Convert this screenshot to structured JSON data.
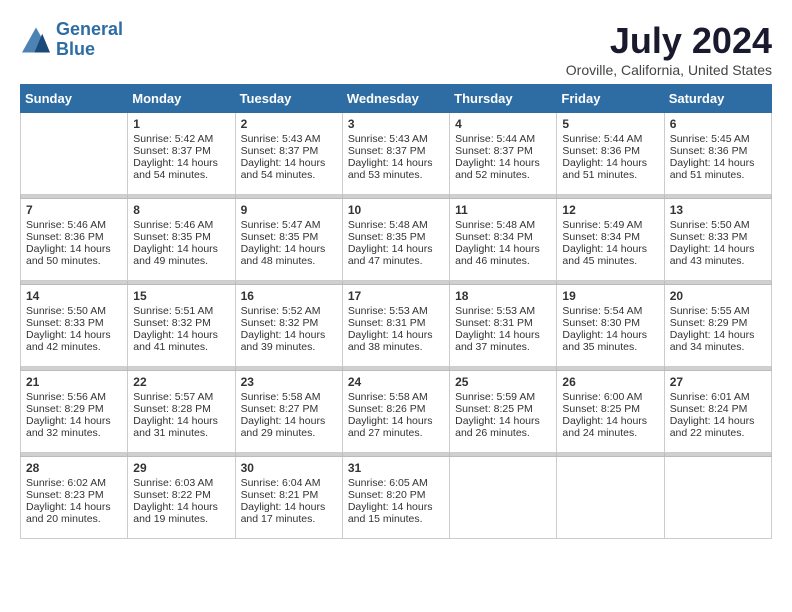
{
  "logo": {
    "line1": "General",
    "line2": "Blue"
  },
  "title": "July 2024",
  "location": "Oroville, California, United States",
  "weekdays": [
    "Sunday",
    "Monday",
    "Tuesday",
    "Wednesday",
    "Thursday",
    "Friday",
    "Saturday"
  ],
  "weeks": [
    [
      {
        "day": "",
        "sunrise": "",
        "sunset": "",
        "daylight": ""
      },
      {
        "day": "1",
        "sunrise": "Sunrise: 5:42 AM",
        "sunset": "Sunset: 8:37 PM",
        "daylight": "Daylight: 14 hours and 54 minutes."
      },
      {
        "day": "2",
        "sunrise": "Sunrise: 5:43 AM",
        "sunset": "Sunset: 8:37 PM",
        "daylight": "Daylight: 14 hours and 54 minutes."
      },
      {
        "day": "3",
        "sunrise": "Sunrise: 5:43 AM",
        "sunset": "Sunset: 8:37 PM",
        "daylight": "Daylight: 14 hours and 53 minutes."
      },
      {
        "day": "4",
        "sunrise": "Sunrise: 5:44 AM",
        "sunset": "Sunset: 8:37 PM",
        "daylight": "Daylight: 14 hours and 52 minutes."
      },
      {
        "day": "5",
        "sunrise": "Sunrise: 5:44 AM",
        "sunset": "Sunset: 8:36 PM",
        "daylight": "Daylight: 14 hours and 51 minutes."
      },
      {
        "day": "6",
        "sunrise": "Sunrise: 5:45 AM",
        "sunset": "Sunset: 8:36 PM",
        "daylight": "Daylight: 14 hours and 51 minutes."
      }
    ],
    [
      {
        "day": "7",
        "sunrise": "Sunrise: 5:46 AM",
        "sunset": "Sunset: 8:36 PM",
        "daylight": "Daylight: 14 hours and 50 minutes."
      },
      {
        "day": "8",
        "sunrise": "Sunrise: 5:46 AM",
        "sunset": "Sunset: 8:35 PM",
        "daylight": "Daylight: 14 hours and 49 minutes."
      },
      {
        "day": "9",
        "sunrise": "Sunrise: 5:47 AM",
        "sunset": "Sunset: 8:35 PM",
        "daylight": "Daylight: 14 hours and 48 minutes."
      },
      {
        "day": "10",
        "sunrise": "Sunrise: 5:48 AM",
        "sunset": "Sunset: 8:35 PM",
        "daylight": "Daylight: 14 hours and 47 minutes."
      },
      {
        "day": "11",
        "sunrise": "Sunrise: 5:48 AM",
        "sunset": "Sunset: 8:34 PM",
        "daylight": "Daylight: 14 hours and 46 minutes."
      },
      {
        "day": "12",
        "sunrise": "Sunrise: 5:49 AM",
        "sunset": "Sunset: 8:34 PM",
        "daylight": "Daylight: 14 hours and 45 minutes."
      },
      {
        "day": "13",
        "sunrise": "Sunrise: 5:50 AM",
        "sunset": "Sunset: 8:33 PM",
        "daylight": "Daylight: 14 hours and 43 minutes."
      }
    ],
    [
      {
        "day": "14",
        "sunrise": "Sunrise: 5:50 AM",
        "sunset": "Sunset: 8:33 PM",
        "daylight": "Daylight: 14 hours and 42 minutes."
      },
      {
        "day": "15",
        "sunrise": "Sunrise: 5:51 AM",
        "sunset": "Sunset: 8:32 PM",
        "daylight": "Daylight: 14 hours and 41 minutes."
      },
      {
        "day": "16",
        "sunrise": "Sunrise: 5:52 AM",
        "sunset": "Sunset: 8:32 PM",
        "daylight": "Daylight: 14 hours and 39 minutes."
      },
      {
        "day": "17",
        "sunrise": "Sunrise: 5:53 AM",
        "sunset": "Sunset: 8:31 PM",
        "daylight": "Daylight: 14 hours and 38 minutes."
      },
      {
        "day": "18",
        "sunrise": "Sunrise: 5:53 AM",
        "sunset": "Sunset: 8:31 PM",
        "daylight": "Daylight: 14 hours and 37 minutes."
      },
      {
        "day": "19",
        "sunrise": "Sunrise: 5:54 AM",
        "sunset": "Sunset: 8:30 PM",
        "daylight": "Daylight: 14 hours and 35 minutes."
      },
      {
        "day": "20",
        "sunrise": "Sunrise: 5:55 AM",
        "sunset": "Sunset: 8:29 PM",
        "daylight": "Daylight: 14 hours and 34 minutes."
      }
    ],
    [
      {
        "day": "21",
        "sunrise": "Sunrise: 5:56 AM",
        "sunset": "Sunset: 8:29 PM",
        "daylight": "Daylight: 14 hours and 32 minutes."
      },
      {
        "day": "22",
        "sunrise": "Sunrise: 5:57 AM",
        "sunset": "Sunset: 8:28 PM",
        "daylight": "Daylight: 14 hours and 31 minutes."
      },
      {
        "day": "23",
        "sunrise": "Sunrise: 5:58 AM",
        "sunset": "Sunset: 8:27 PM",
        "daylight": "Daylight: 14 hours and 29 minutes."
      },
      {
        "day": "24",
        "sunrise": "Sunrise: 5:58 AM",
        "sunset": "Sunset: 8:26 PM",
        "daylight": "Daylight: 14 hours and 27 minutes."
      },
      {
        "day": "25",
        "sunrise": "Sunrise: 5:59 AM",
        "sunset": "Sunset: 8:25 PM",
        "daylight": "Daylight: 14 hours and 26 minutes."
      },
      {
        "day": "26",
        "sunrise": "Sunrise: 6:00 AM",
        "sunset": "Sunset: 8:25 PM",
        "daylight": "Daylight: 14 hours and 24 minutes."
      },
      {
        "day": "27",
        "sunrise": "Sunrise: 6:01 AM",
        "sunset": "Sunset: 8:24 PM",
        "daylight": "Daylight: 14 hours and 22 minutes."
      }
    ],
    [
      {
        "day": "28",
        "sunrise": "Sunrise: 6:02 AM",
        "sunset": "Sunset: 8:23 PM",
        "daylight": "Daylight: 14 hours and 20 minutes."
      },
      {
        "day": "29",
        "sunrise": "Sunrise: 6:03 AM",
        "sunset": "Sunset: 8:22 PM",
        "daylight": "Daylight: 14 hours and 19 minutes."
      },
      {
        "day": "30",
        "sunrise": "Sunrise: 6:04 AM",
        "sunset": "Sunset: 8:21 PM",
        "daylight": "Daylight: 14 hours and 17 minutes."
      },
      {
        "day": "31",
        "sunrise": "Sunrise: 6:05 AM",
        "sunset": "Sunset: 8:20 PM",
        "daylight": "Daylight: 14 hours and 15 minutes."
      },
      {
        "day": "",
        "sunrise": "",
        "sunset": "",
        "daylight": ""
      },
      {
        "day": "",
        "sunrise": "",
        "sunset": "",
        "daylight": ""
      },
      {
        "day": "",
        "sunrise": "",
        "sunset": "",
        "daylight": ""
      }
    ]
  ]
}
